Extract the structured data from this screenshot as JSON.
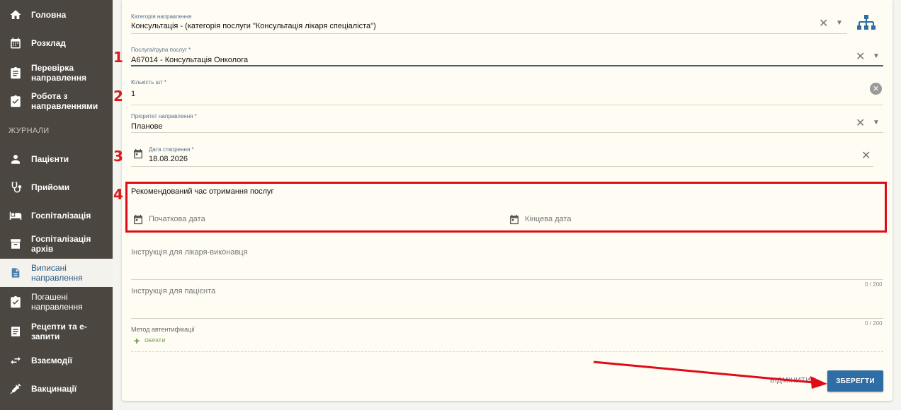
{
  "sidebar": {
    "items": [
      {
        "label": "Головна",
        "icon": "home-icon"
      },
      {
        "label": "Розклад",
        "icon": "calendar-icon"
      },
      {
        "label": "Перевірка направлення",
        "icon": "clipboard-check-icon"
      },
      {
        "label": "Робота з направленнями",
        "icon": "clipboard-icon"
      },
      {
        "label": "Пацієнти",
        "icon": "person-icon"
      },
      {
        "label": "Прийоми",
        "icon": "stethoscope-icon"
      },
      {
        "label": "Госпіталізація",
        "icon": "bed-icon"
      },
      {
        "label": "Госпіталізація архів",
        "icon": "archive-icon"
      },
      {
        "label": "Виписані направлення",
        "icon": "document-icon"
      },
      {
        "label": "Погашені направлення",
        "icon": "clipboard-done-icon"
      },
      {
        "label": "Рецепти та е-запити",
        "icon": "receipt-icon"
      },
      {
        "label": "Взаємодії",
        "icon": "swap-icon"
      },
      {
        "label": "Вакцинації",
        "icon": "syringe-icon"
      }
    ],
    "section_journals": "ЖУРНАЛИ"
  },
  "form": {
    "category": {
      "label": "Категорія направлення",
      "value": "Консультація - (категорія послуги \"Консультація лікаря спеціаліста\")"
    },
    "service": {
      "label": "Послуга/група послуг *",
      "value": "A67014 - Консультація Онколога"
    },
    "quantity": {
      "label": "Кількість шт *",
      "value": "1"
    },
    "priority": {
      "label": "Пріоритет направлення *",
      "value": "Планове"
    },
    "created_date": {
      "label": "Дата створення *",
      "value": "18.08.2026"
    },
    "recommended": {
      "title": "Рекомендований час отримання послуг",
      "start_placeholder": "Початкова дата",
      "end_placeholder": "Кінцева дата"
    },
    "doctor_instructions": {
      "label": "Інструкція для лікаря-виконавця",
      "counter": "0 / 200"
    },
    "patient_instructions": {
      "label": "Інструкція для пацієнта",
      "counter": "0 / 200"
    },
    "auth_method": {
      "label": "Метод автентифікації",
      "choose": "ОБРАТИ"
    },
    "cancel": "ВІДМІНИТИ",
    "save": "ЗБЕРЕГТИ"
  },
  "annotations": {
    "n1": "1",
    "n2": "2",
    "n3": "3",
    "n4": "4"
  },
  "colors": {
    "sidebar": "#4b4740",
    "accent": "#2f6ea4",
    "highlight": "#e10a17"
  }
}
